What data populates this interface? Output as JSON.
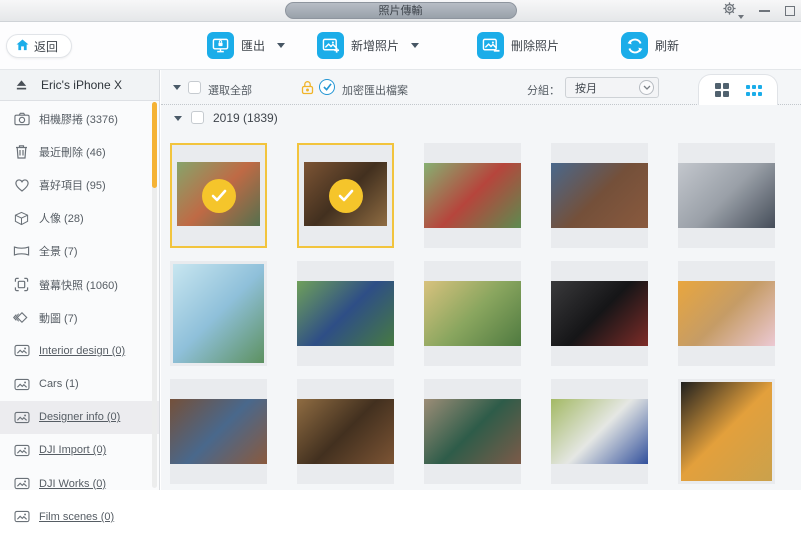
{
  "titlebar": {
    "tab_label": "照片傳輸"
  },
  "toolbar": {
    "back_label": "返回",
    "buttons": [
      {
        "name": "export-button",
        "label": "匯出",
        "icon": "monitor-export-icon",
        "dropdown": true
      },
      {
        "name": "add-photos-button",
        "label": "新增照片",
        "icon": "add-photo-icon",
        "dropdown": true
      },
      {
        "name": "delete-photos-button",
        "label": "刪除照片",
        "icon": "remove-photo-icon",
        "dropdown": false
      },
      {
        "name": "refresh-button",
        "label": "刷新",
        "icon": "refresh-icon",
        "dropdown": false
      }
    ]
  },
  "sidebar": {
    "device_name": "Eric's iPhone X",
    "items": [
      {
        "label": "相機膠捲",
        "count": "(3376)",
        "icon": "camera-icon",
        "underline": false,
        "highlight": false
      },
      {
        "label": "最近刪除",
        "count": "(46)",
        "icon": "trash-icon",
        "underline": false,
        "highlight": false
      },
      {
        "label": "喜好項目",
        "count": "(95)",
        "icon": "heart-icon",
        "underline": false,
        "highlight": false
      },
      {
        "label": "人像",
        "count": "(28)",
        "icon": "cube-icon",
        "underline": false,
        "highlight": false
      },
      {
        "label": "全景",
        "count": "(7)",
        "icon": "panorama-icon",
        "underline": false,
        "highlight": false
      },
      {
        "label": "螢幕快照",
        "count": "(1060)",
        "icon": "screenshot-icon",
        "underline": false,
        "highlight": false
      },
      {
        "label": "動圖",
        "count": "(7)",
        "icon": "live-photo-icon",
        "underline": false,
        "highlight": false
      },
      {
        "label": "Interior design",
        "count": "(0)",
        "icon": "album-icon",
        "underline": true,
        "highlight": false
      },
      {
        "label": "Cars",
        "count": "(1)",
        "icon": "album-icon",
        "underline": false,
        "highlight": false
      },
      {
        "label": "Designer info",
        "count": "(0)",
        "icon": "album-icon",
        "underline": true,
        "highlight": true
      },
      {
        "label": "DJI Import",
        "count": "(0)",
        "icon": "album-icon",
        "underline": true,
        "highlight": false
      },
      {
        "label": "DJI Works",
        "count": "(0)",
        "icon": "album-icon",
        "underline": true,
        "highlight": false
      },
      {
        "label": "Film scenes",
        "count": "(0)",
        "icon": "album-icon",
        "underline": true,
        "highlight": false
      }
    ]
  },
  "filterbar": {
    "select_all_label": "選取全部",
    "select_all_checked": false,
    "encrypt_label": "加密匯出檔案",
    "encrypt_checked": true,
    "group_label": "分組：",
    "group_value": "按月",
    "view_active": "grid-small"
  },
  "grid": {
    "group_title": "2019 (1839)",
    "photos": [
      {
        "desc": "cactus-pots",
        "selected": true,
        "tall": false,
        "colors": [
          "#86a46b",
          "#bf6a45",
          "#55704e"
        ]
      },
      {
        "desc": "pizza-on-table",
        "selected": true,
        "tall": false,
        "colors": [
          "#7c5434",
          "#42301f",
          "#8f6c42"
        ]
      },
      {
        "desc": "toddler-blowing-bubbles",
        "selected": false,
        "tall": false,
        "colors": [
          "#86b072",
          "#b6453c",
          "#5d8b50"
        ]
      },
      {
        "desc": "dog-being-petted",
        "selected": false,
        "tall": false,
        "colors": [
          "#49688c",
          "#74503a",
          "#8a5a3e"
        ]
      },
      {
        "desc": "runner-tying-shoes",
        "selected": false,
        "tall": false,
        "colors": [
          "#c3c7cd",
          "#9aa0a8",
          "#454d59"
        ]
      },
      {
        "desc": "coastal-road",
        "selected": false,
        "tall": true,
        "colors": [
          "#c8e6f0",
          "#8fc0da",
          "#5d9160"
        ]
      },
      {
        "desc": "child-in-park",
        "selected": false,
        "tall": false,
        "colors": [
          "#6fa05a",
          "#2e4e86",
          "#477a42"
        ]
      },
      {
        "desc": "woman-in-park",
        "selected": false,
        "tall": false,
        "colors": [
          "#d8c27e",
          "#8aa65f",
          "#4f7a40"
        ]
      },
      {
        "desc": "man-with-camera",
        "selected": false,
        "tall": false,
        "colors": [
          "#3a3a3c",
          "#151517",
          "#7e2c28"
        ]
      },
      {
        "desc": "pumpkin-soup",
        "selected": false,
        "tall": false,
        "colors": [
          "#e9a63e",
          "#c59c66",
          "#ecc9d4"
        ]
      },
      {
        "desc": "dog-being-petted",
        "selected": false,
        "tall": false,
        "colors": [
          "#74503a",
          "#49688c",
          "#8a5a3e"
        ]
      },
      {
        "desc": "pizza-on-table",
        "selected": false,
        "tall": false,
        "colors": [
          "#8f6c42",
          "#42301f",
          "#7c5434"
        ]
      },
      {
        "desc": "green-front-door",
        "selected": false,
        "tall": false,
        "colors": [
          "#9c8d77",
          "#2e5c49",
          "#7c5b49"
        ]
      },
      {
        "desc": "salad-plate",
        "selected": false,
        "tall": false,
        "colors": [
          "#a3b964",
          "#e5e7e4",
          "#32509c"
        ]
      },
      {
        "desc": "apricots-on-dark",
        "selected": false,
        "tall": true,
        "colors": [
          "#20201f",
          "#e3a03c",
          "#caa14c"
        ]
      }
    ]
  },
  "colors": {
    "accent_blue": "#1BADE9",
    "selection_gold": "#F5C52B",
    "selection_border": "#F2C43D",
    "scrollbar_orange": "#F5B335",
    "lock_yellow": "#F0B429"
  }
}
